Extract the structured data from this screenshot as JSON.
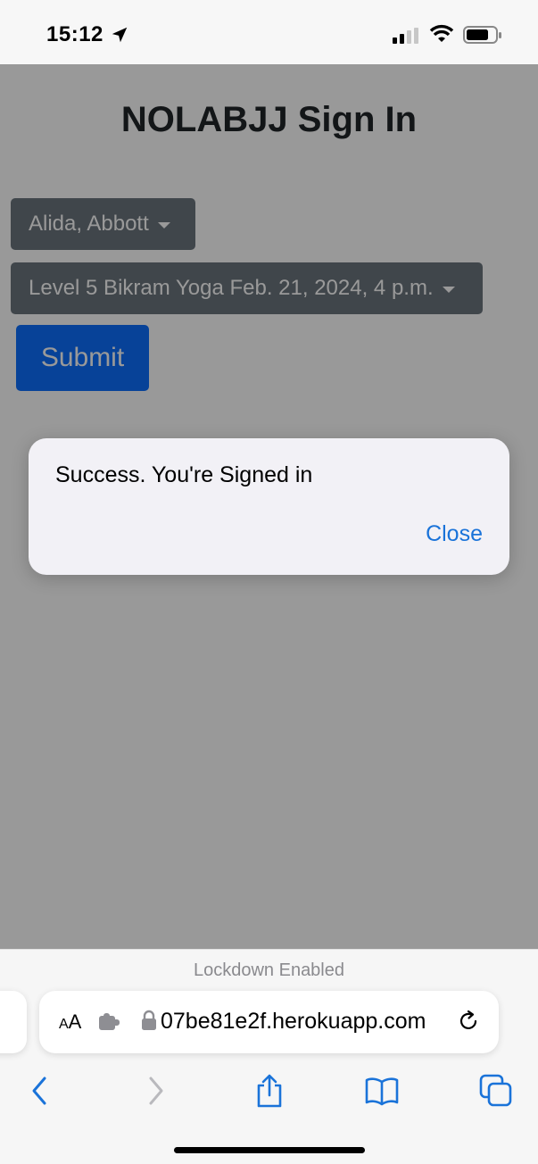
{
  "status_bar": {
    "time": "15:12"
  },
  "page": {
    "title": "NOLABJJ Sign In",
    "member_select": {
      "value": "Alida, Abbott"
    },
    "class_select": {
      "value": "Level 5 Bikram Yoga Feb. 21, 2024, 4 p.m."
    },
    "submit_label": "Submit"
  },
  "alert": {
    "message": "Success. You're Signed in",
    "close_label": "Close"
  },
  "browser": {
    "lockdown_text": "Lockdown Enabled",
    "aa_small": "A",
    "aa_large": "A",
    "url": "07be81e2f.herokuapp.com"
  },
  "colors": {
    "accent": "#0d6efd",
    "link": "#1a73d9",
    "dropdown_bg": "#6c757d"
  }
}
